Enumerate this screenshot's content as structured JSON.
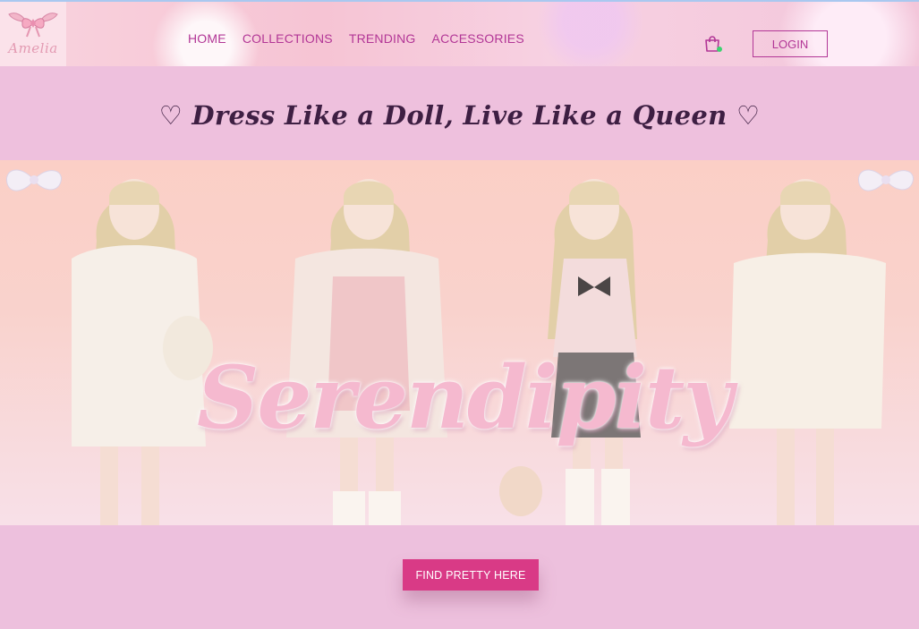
{
  "brand": {
    "logo_text": "Amelia"
  },
  "nav": {
    "links": [
      {
        "label": "HOME"
      },
      {
        "label": "COLLECTIONS"
      },
      {
        "label": "TRENDING"
      },
      {
        "label": "ACCESSORIES"
      }
    ],
    "cart_icon": "shopping-bag-icon",
    "login_label": "LOGIN"
  },
  "hero": {
    "tagline": "♡ Dress Like a Doll, Live Like a Queen ♡",
    "banner_script": "Serendipity"
  },
  "cta": {
    "label": "FIND PRETTY HERE"
  },
  "colors": {
    "accent": "#b23696",
    "cta": "#d93a86",
    "background": "#edc0dd",
    "tagline": "#3e1f43",
    "status_dot": "#3cd370"
  }
}
